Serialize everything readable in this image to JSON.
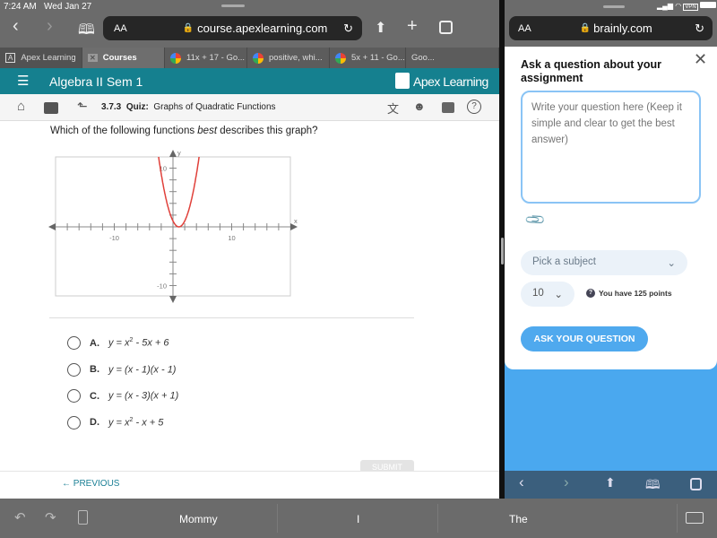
{
  "status": {
    "time": "7:24 AM",
    "date": "Wed Jan 27",
    "vpn": "VPN"
  },
  "left_browser": {
    "aa": "AA",
    "url": "course.apexlearning.com",
    "tabs": [
      {
        "label": "Apex Learning",
        "icon": "apex-icon"
      },
      {
        "label": "Courses",
        "icon": "close-icon",
        "active": true
      },
      {
        "label": "11x + 17 - Go...",
        "icon": "google-icon"
      },
      {
        "label": "positive, whi...",
        "icon": "google-icon"
      },
      {
        "label": "5x + 11 - Go...",
        "icon": "google-icon"
      },
      {
        "label": "Goo...",
        "icon": ""
      }
    ]
  },
  "header": {
    "title": "Algebra II Sem 1",
    "logo": "Apex Learning"
  },
  "breadcrumb": {
    "number": "3.7.3",
    "type": "Quiz:",
    "title": "Graphs of Quadratic Functions"
  },
  "question": {
    "pre": "Which of the following functions ",
    "em": "best",
    "post": " describes this graph?"
  },
  "chart_data": {
    "type": "line",
    "xlabel": "x",
    "ylabel": "y",
    "xlim": [
      -20,
      20
    ],
    "ylim": [
      -12,
      12
    ],
    "x_tick_step": 2,
    "y_tick_step": 2,
    "x_tick_labels": [
      "-10",
      "10"
    ],
    "y_tick_labels": [
      "10",
      "-10"
    ],
    "grid": false,
    "series": [
      {
        "function": "y = (x - 1)^2",
        "color": "#e0403a",
        "points": [
          [
            -1.5,
            6.25
          ],
          [
            -1,
            4
          ],
          [
            0,
            1
          ],
          [
            1,
            0
          ],
          [
            2,
            1
          ],
          [
            3,
            4
          ],
          [
            3.5,
            6.25
          ],
          [
            4,
            9
          ],
          [
            4.6,
            12.96
          ]
        ]
      }
    ]
  },
  "options": [
    {
      "letter": "A.",
      "pre": "y = x",
      "sup": "2",
      "post": " - 5x + 6"
    },
    {
      "letter": "B.",
      "pre": "y = (x - 1)(x - 1)",
      "sup": "",
      "post": ""
    },
    {
      "letter": "C.",
      "pre": "y = (x - 3)(x + 1)",
      "sup": "",
      "post": ""
    },
    {
      "letter": "D.",
      "pre": "y = x",
      "sup": "2",
      "post": " - x + 5"
    }
  ],
  "submit": "SUBMIT",
  "previous": "PREVIOUS",
  "right_browser": {
    "aa": "AA",
    "url": "brainly.com"
  },
  "brainly": {
    "title": "Ask a question about your assignment",
    "placeholder": "Write your question here (Keep it simple and clear to get the best answer)",
    "subject": "Pick a subject",
    "points_value": "10",
    "points_text": "You have 125 points",
    "ask": "ASK YOUR QUESTION",
    "colors": {
      "accent": "#4fa9ee",
      "blue_bg": "#4aa8ef"
    }
  },
  "keyboard": {
    "suggestions": [
      "Mommy",
      "I",
      "The"
    ]
  }
}
